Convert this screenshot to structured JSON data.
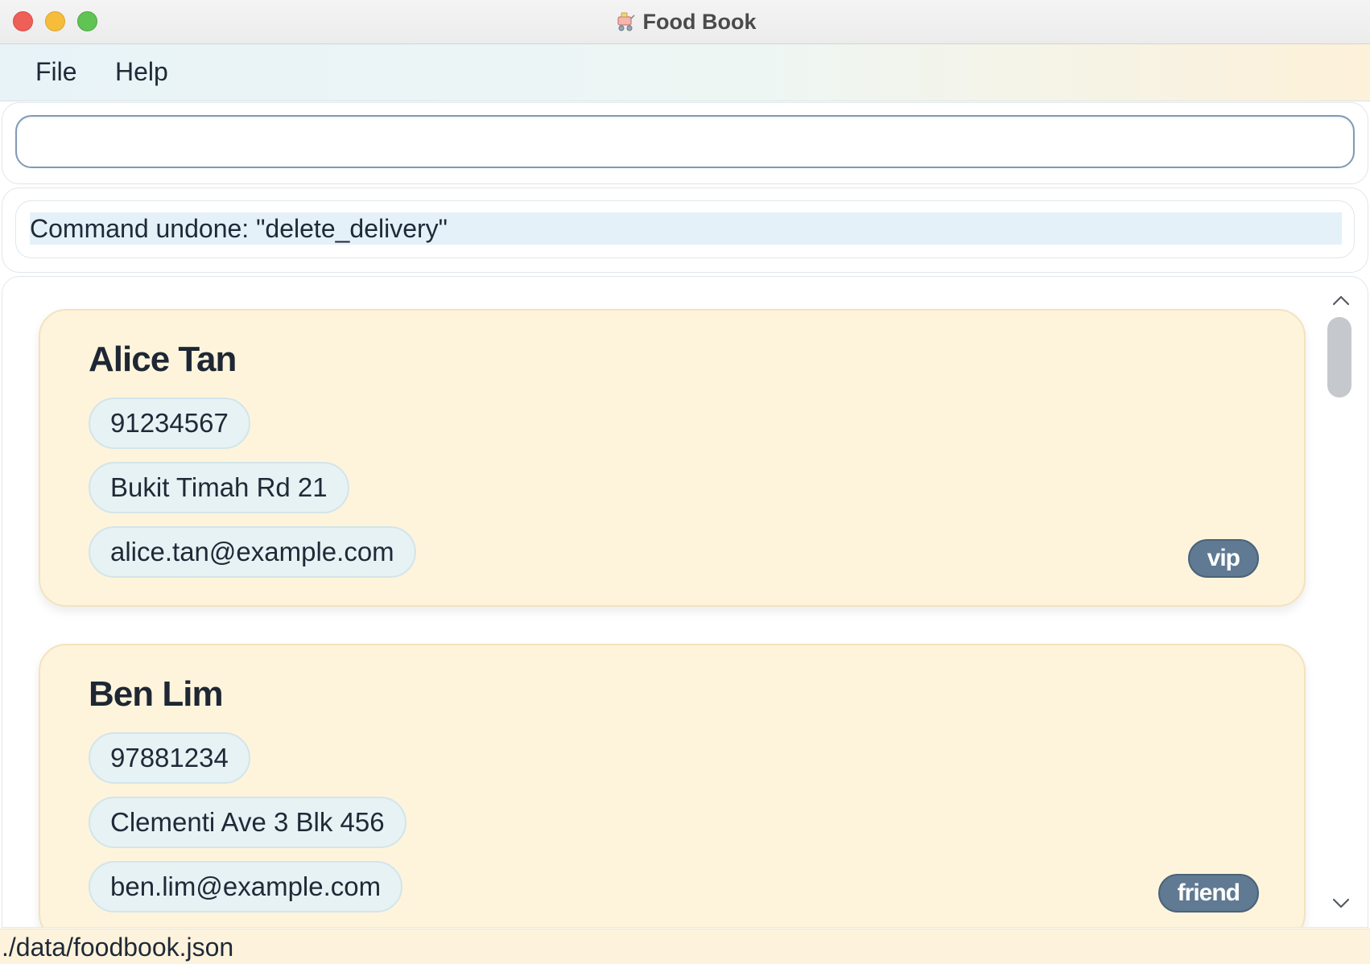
{
  "window": {
    "title": "Food Book",
    "app_icon": "food-cart-icon"
  },
  "menu": {
    "file_label": "File",
    "help_label": "Help"
  },
  "command_box": {
    "value": "",
    "placeholder": ""
  },
  "result": {
    "text": "Command undone: \"delete_delivery\""
  },
  "persons": [
    {
      "name": "Alice Tan",
      "phone": "91234567",
      "address": "Bukit Timah Rd 21",
      "email": "alice.tan@example.com",
      "tag": "vip"
    },
    {
      "name": "Ben Lim",
      "phone": "97881234",
      "address": "Clementi Ave 3 Blk 456",
      "email": "ben.lim@example.com",
      "tag": "friend"
    }
  ],
  "status_bar": {
    "file_path": "./data/foodbook.json"
  },
  "colors": {
    "card_bg": "#fef4dc",
    "chip_bg": "#e6f2f4",
    "tag_bg": "#5f7a92",
    "result_highlight": "#e4f1f9",
    "close": "#ee5f57",
    "minimize": "#f6bd3b",
    "maximize": "#5fc454"
  }
}
